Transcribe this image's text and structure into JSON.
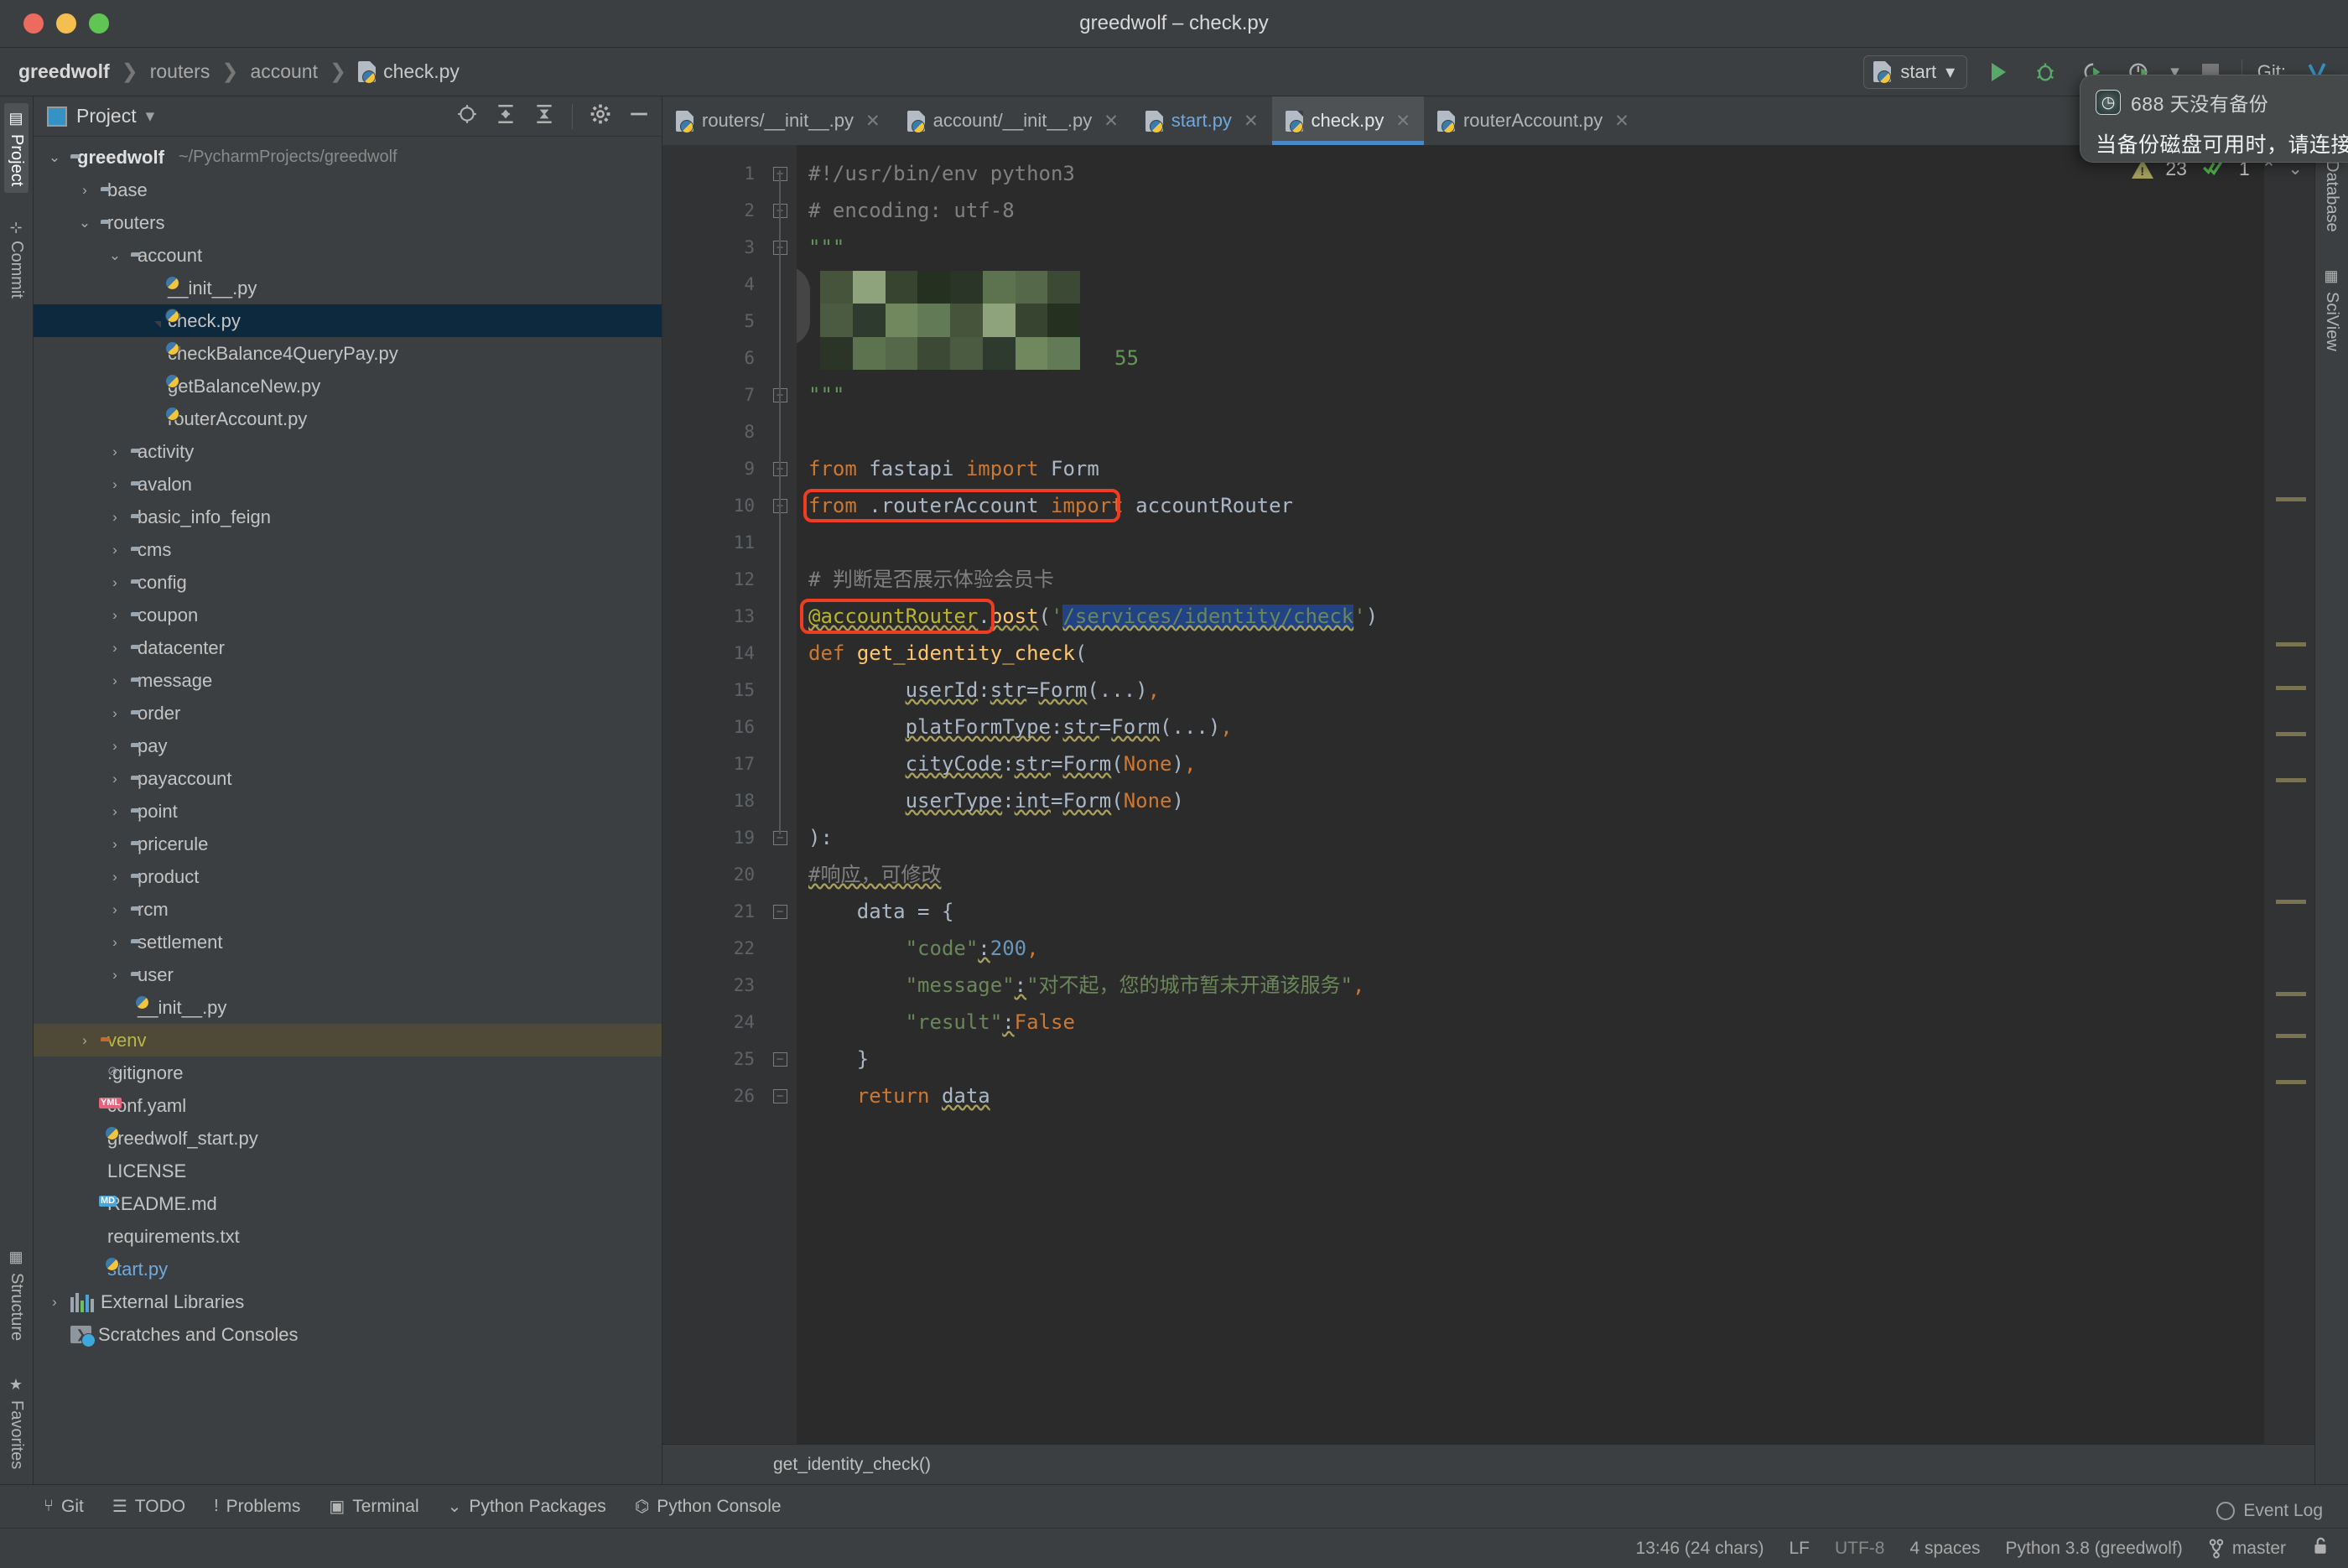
{
  "window": {
    "title": "greedwolf – check.py"
  },
  "breadcrumb": {
    "project": "greedwolf",
    "segments": [
      "routers",
      "account"
    ],
    "file": "check.py",
    "separator": "❯"
  },
  "toolbar": {
    "run_config": "start",
    "run_label": "run-button",
    "debug_label": "debug-button",
    "coverage_label": "coverage-button",
    "profile_label": "profile-button",
    "stop_label": "stop-button",
    "git_label": "Git:",
    "dropdown_caret": "▾"
  },
  "notification": {
    "title": "688 天没有备份",
    "body": "当备份磁盘可用时，请连接"
  },
  "left_strip": {
    "top": [
      {
        "label": "Project",
        "active": true
      },
      {
        "label": "Commit",
        "active": false
      }
    ],
    "bottom": [
      {
        "label": "Structure",
        "active": false
      },
      {
        "label": "Favorites",
        "active": false
      }
    ]
  },
  "right_strip": {
    "items": [
      {
        "label": "Database"
      },
      {
        "label": "SciView"
      }
    ]
  },
  "project_panel": {
    "title": "Project",
    "caret": "▾",
    "icons": [
      "locate-icon",
      "expand-all-icon",
      "collapse-all-icon",
      "settings-gear-icon",
      "minimize-icon"
    ],
    "tree": [
      {
        "label": "greedwolf",
        "note": "~/PycharmProjects/greedwolf",
        "icon": "folder",
        "indent": 0,
        "arrow": "down",
        "bold": true
      },
      {
        "label": "base",
        "icon": "folder",
        "indent": 1,
        "arrow": "right"
      },
      {
        "label": "routers",
        "icon": "folder",
        "indent": 1,
        "arrow": "down"
      },
      {
        "label": "account",
        "icon": "folder",
        "indent": 2,
        "arrow": "down"
      },
      {
        "label": "__init__.py",
        "icon": "python",
        "indent": 3,
        "arrow": "none"
      },
      {
        "label": "check.py",
        "icon": "python",
        "indent": 3,
        "arrow": "none",
        "selected": true
      },
      {
        "label": "checkBalance4QueryPay.py",
        "icon": "python",
        "indent": 3,
        "arrow": "none"
      },
      {
        "label": "getBalanceNew.py",
        "icon": "python",
        "indent": 3,
        "arrow": "none"
      },
      {
        "label": "routerAccount.py",
        "icon": "python",
        "indent": 3,
        "arrow": "none"
      },
      {
        "label": "activity",
        "icon": "folder",
        "indent": 2,
        "arrow": "right"
      },
      {
        "label": "avalon",
        "icon": "folder",
        "indent": 2,
        "arrow": "right"
      },
      {
        "label": "basic_info_feign",
        "icon": "folder",
        "indent": 2,
        "arrow": "right"
      },
      {
        "label": "cms",
        "icon": "folder",
        "indent": 2,
        "arrow": "right"
      },
      {
        "label": "config",
        "icon": "folder",
        "indent": 2,
        "arrow": "right"
      },
      {
        "label": "coupon",
        "icon": "folder",
        "indent": 2,
        "arrow": "right"
      },
      {
        "label": "datacenter",
        "icon": "folder",
        "indent": 2,
        "arrow": "right"
      },
      {
        "label": "message",
        "icon": "folder",
        "indent": 2,
        "arrow": "right"
      },
      {
        "label": "order",
        "icon": "folder",
        "indent": 2,
        "arrow": "right"
      },
      {
        "label": "pay",
        "icon": "folder",
        "indent": 2,
        "arrow": "right"
      },
      {
        "label": "payaccount",
        "icon": "folder",
        "indent": 2,
        "arrow": "right"
      },
      {
        "label": "point",
        "icon": "folder",
        "indent": 2,
        "arrow": "right"
      },
      {
        "label": "pricerule",
        "icon": "folder",
        "indent": 2,
        "arrow": "right"
      },
      {
        "label": "product",
        "icon": "folder",
        "indent": 2,
        "arrow": "right"
      },
      {
        "label": "rcm",
        "icon": "folder",
        "indent": 2,
        "arrow": "right"
      },
      {
        "label": "settlement",
        "icon": "folder",
        "indent": 2,
        "arrow": "right"
      },
      {
        "label": "user",
        "icon": "folder",
        "indent": 2,
        "arrow": "right"
      },
      {
        "label": "__init__.py",
        "icon": "python",
        "indent": 2,
        "arrow": "none"
      },
      {
        "label": "venv",
        "icon": "folder-orange",
        "indent": 1,
        "arrow": "right",
        "hover": true,
        "color": "venv"
      },
      {
        "label": ".gitignore",
        "icon": "gitignore",
        "indent": 1,
        "arrow": "none"
      },
      {
        "label": "conf.yaml",
        "icon": "yaml",
        "indent": 1,
        "arrow": "none"
      },
      {
        "label": "greedwolf_start.py",
        "icon": "python",
        "indent": 1,
        "arrow": "none"
      },
      {
        "label": "LICENSE",
        "icon": "text",
        "indent": 1,
        "arrow": "none"
      },
      {
        "label": "README.md",
        "icon": "markdown",
        "indent": 1,
        "arrow": "none"
      },
      {
        "label": "requirements.txt",
        "icon": "text",
        "indent": 1,
        "arrow": "none"
      },
      {
        "label": "start.py",
        "icon": "python",
        "indent": 1,
        "arrow": "none",
        "color": "blue"
      },
      {
        "label": "External Libraries",
        "icon": "library",
        "indent": 0,
        "arrow": "right"
      },
      {
        "label": "Scratches and Consoles",
        "icon": "scratch",
        "indent": 0,
        "arrow": "none"
      }
    ]
  },
  "editor": {
    "tabs": [
      {
        "label": "routers/__init__.py",
        "active": false,
        "vcs": false
      },
      {
        "label": "account/__init__.py",
        "active": false,
        "vcs": false
      },
      {
        "label": "start.py",
        "active": false,
        "vcs": true
      },
      {
        "label": "check.py",
        "active": true,
        "vcs": false
      },
      {
        "label": "routerAccount.py",
        "active": false,
        "vcs": false
      }
    ],
    "close_glyph": "✕",
    "inspection": {
      "warnings": "23",
      "checks": "1",
      "up": "⌃",
      "down": "⌄"
    },
    "breadcrumb": "get_identity_check()",
    "lines": [
      {
        "n": "1",
        "text": "#!/usr/bin/env python3"
      },
      {
        "n": "2",
        "text": "# encoding: utf-8"
      },
      {
        "n": "3",
        "text": "\"\"\""
      },
      {
        "n": "4",
        "text": ""
      },
      {
        "n": "5",
        "text": ""
      },
      {
        "n": "6",
        "text": ""
      },
      {
        "n": "7",
        "text": "\"\"\""
      },
      {
        "n": "8",
        "text": ""
      },
      {
        "n": "9",
        "text": "from fastapi import Form"
      },
      {
        "n": "10",
        "text": "from .routerAccount import accountRouter"
      },
      {
        "n": "11",
        "text": ""
      },
      {
        "n": "12",
        "text": "# 判断是否展示体验会员卡"
      },
      {
        "n": "13",
        "text": "@accountRouter.post('/services/identity/check')"
      },
      {
        "n": "14",
        "text": "def get_identity_check("
      },
      {
        "n": "15",
        "text": "        userId:str=Form(...),"
      },
      {
        "n": "16",
        "text": "        platFormType:str=Form(...),"
      },
      {
        "n": "17",
        "text": "        cityCode:str=Form(None),"
      },
      {
        "n": "18",
        "text": "        userType:int=Form(None)"
      },
      {
        "n": "19",
        "text": "):"
      },
      {
        "n": "20",
        "text": "#响应，可修改"
      },
      {
        "n": "21",
        "text": "    data = {"
      },
      {
        "n": "22",
        "text": "        \"code\":200,"
      },
      {
        "n": "23",
        "text": "        \"message\":\"对不起，您的城市暂未开通该服务\","
      },
      {
        "n": "24",
        "text": "        \"result\":False"
      },
      {
        "n": "25",
        "text": "    }"
      },
      {
        "n": "26",
        "text": "    return data"
      }
    ],
    "line6_fragment": "55",
    "annotations": {
      "box1_target": "from .routerAccount import accountRouter",
      "box2_target": "@accountRouter",
      "selection": "/services/identity/check",
      "highlight_color": "#f03c20",
      "selection_color": "#214283"
    }
  },
  "bottom_tools": [
    {
      "label": "Git",
      "icon": "git-branch-icon"
    },
    {
      "label": "TODO",
      "icon": "list-icon"
    },
    {
      "label": "Problems",
      "icon": "exclamation-circle-icon"
    },
    {
      "label": "Terminal",
      "icon": "terminal-icon"
    },
    {
      "label": "Python Packages",
      "icon": "chevron-stack-icon"
    },
    {
      "label": "Python Console",
      "icon": "python-icon"
    }
  ],
  "statusbar": {
    "caret": "13:46 (24 chars)",
    "line_sep": "LF",
    "encoding": "UTF-8",
    "indent": "4 spaces",
    "interpreter": "Python 3.8 (greedwolf)",
    "branch": "master",
    "event_log": "Event Log",
    "lock_icon": "lock-open-icon"
  }
}
